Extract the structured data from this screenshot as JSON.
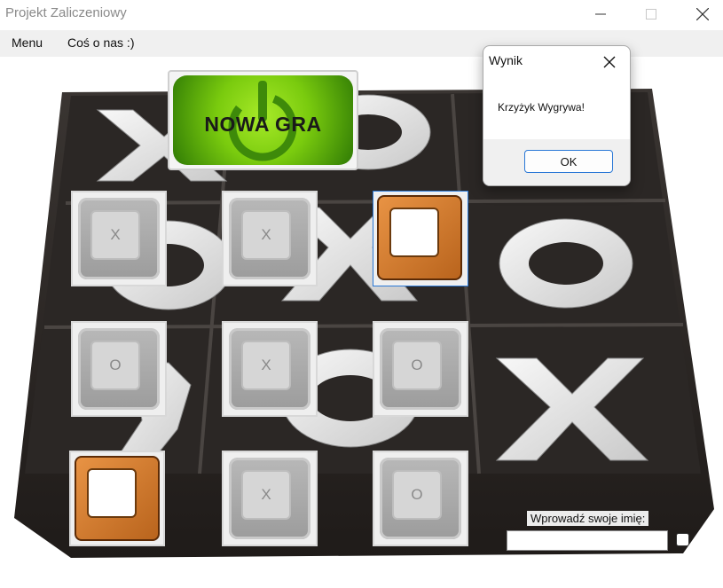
{
  "window": {
    "title": "Projekt Zaliczeniowy"
  },
  "menu": {
    "items": [
      "Menu",
      "Coś o nas :)"
    ]
  },
  "new_game_label": "NOWA GRA",
  "grid": {
    "row1": [
      {
        "style": "grey",
        "symbol": "X"
      },
      {
        "style": "grey",
        "symbol": "X"
      },
      {
        "style": "orange",
        "symbol": ""
      }
    ],
    "row2": [
      {
        "style": "grey",
        "symbol": "O"
      },
      {
        "style": "grey",
        "symbol": "X"
      },
      {
        "style": "grey",
        "symbol": "O"
      }
    ],
    "row3": [
      {
        "style": "orange",
        "symbol": ""
      },
      {
        "style": "grey",
        "symbol": "X"
      },
      {
        "style": "grey",
        "symbol": "O"
      }
    ]
  },
  "dialog": {
    "title": "Wynik",
    "message": "Krzyżyk Wygrywa!",
    "ok_label": "OK"
  },
  "name_entry": {
    "label": "Wprowadź swoje imię:",
    "value": "",
    "checkbox_checked": false
  },
  "colors": {
    "accent": "#2a78d6",
    "tile_orange": "#d9822b",
    "board_dark": "#2e2a28"
  }
}
